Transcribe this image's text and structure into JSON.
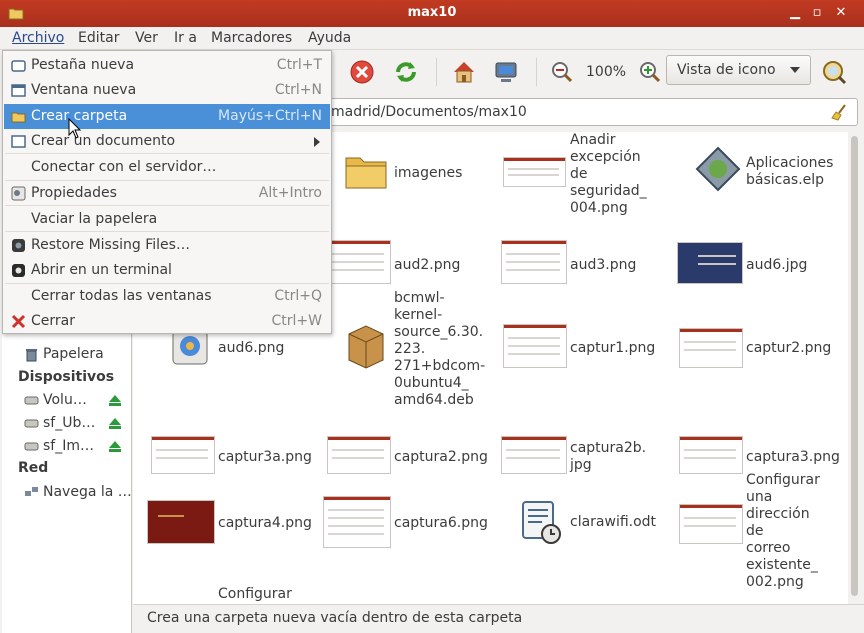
{
  "window": {
    "title": "max10"
  },
  "menubar": [
    "Archivo",
    "Editar",
    "Ver",
    "Ir a",
    "Marcadores",
    "Ayuda"
  ],
  "toolbar": {
    "zoom": "100%",
    "view_mode": "Vista de icono"
  },
  "location": {
    "path": "madrid/Documentos/max10"
  },
  "sidebar": {
    "places": [
      "Papelera"
    ],
    "devices_header": "Dispositivos",
    "devices": [
      "Volu…",
      "sf_Ub…",
      "sf_Im…"
    ],
    "network_header": "Red",
    "network": [
      "Navega la …"
    ]
  },
  "files": [
    {
      "name": "imagenes"
    },
    {
      "name": "Anadir\nexcepción\nde\nseguridad_\n004.png"
    },
    {
      "name": "Aplicaciones\nbásicas.elp"
    },
    {
      "name": "aud2.png"
    },
    {
      "name": "aud3.png"
    },
    {
      "name": "aud6.jpg"
    },
    {
      "name": "aud6.png"
    },
    {
      "name": "bcmwl-\nkernel-\nsource_6.30.\n223.\n271+bdcom-\n0ubuntu4_\namd64.deb"
    },
    {
      "name": "captur1.png"
    },
    {
      "name": "captur2.png"
    },
    {
      "name": "captur3a.png"
    },
    {
      "name": "captura2.png"
    },
    {
      "name": "captura2b.\njpg"
    },
    {
      "name": "captura3.png"
    },
    {
      "name": "captura4.png"
    },
    {
      "name": "captura6.png"
    },
    {
      "name": "clarawifi.odt"
    },
    {
      "name": "Configurar\nuna\ndirección\nde\ncorreo\nexistente_\n002.png"
    },
    {
      "name": "Configurar"
    }
  ],
  "menu": {
    "items": [
      {
        "label": "Pestaña nueva",
        "shortcut": "Ctrl+T"
      },
      {
        "label": "Ventana nueva",
        "shortcut": "Ctrl+N"
      },
      {
        "label": "Crear carpeta",
        "shortcut": "Mayús+Ctrl+N"
      },
      {
        "label": "Crear un documento",
        "shortcut": ""
      },
      {
        "label": "Conectar con el servidor…",
        "shortcut": ""
      },
      {
        "label": "Propiedades",
        "shortcut": "Alt+Intro"
      },
      {
        "label": "Vaciar la papelera",
        "shortcut": ""
      },
      {
        "label": "Restore Missing Files…",
        "shortcut": ""
      },
      {
        "label": "Abrir en un terminal",
        "shortcut": ""
      },
      {
        "label": "Cerrar todas las ventanas",
        "shortcut": "Ctrl+Q"
      },
      {
        "label": "Cerrar",
        "shortcut": "Ctrl+W"
      }
    ]
  },
  "status": {
    "text": "Crea una carpeta nueva vacía dentro de esta carpeta"
  },
  "colors": {
    "titlebar": "#b8351f",
    "highlight": "#4a90d9",
    "folder": "#e8b84a"
  }
}
